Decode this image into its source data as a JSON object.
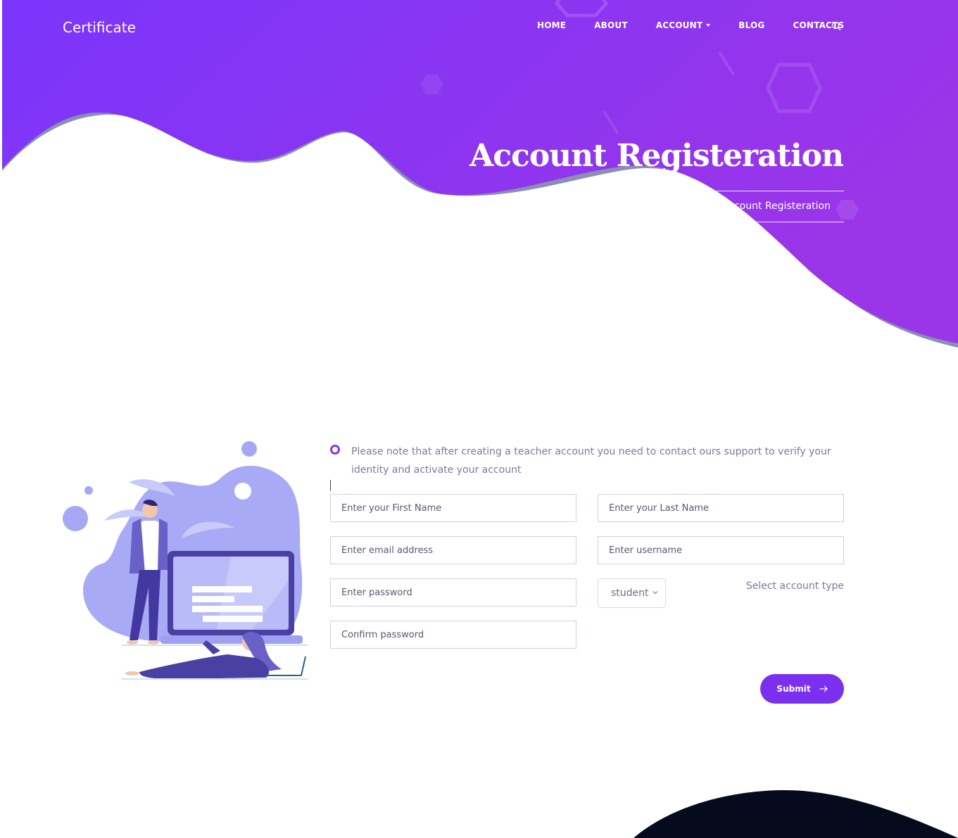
{
  "brand": {
    "name": "Certificate"
  },
  "nav": {
    "items": [
      "HOME",
      "ABOUT",
      "ACCOUNT",
      "BLOG",
      "CONTACTS"
    ],
    "search_icon": "search-icon"
  },
  "hero": {
    "title": "Account Registeration",
    "breadcrumb": "Account Registeration"
  },
  "form": {
    "note": "Please note that after creating a teacher account you need to contact ours support to verify your identity and activate your account",
    "first_name_placeholder": "Enter your First Name",
    "last_name_placeholder": "Enter your Last Name",
    "email_placeholder": "Enter email address",
    "username_placeholder": "Enter username",
    "password_placeholder": "Enter password",
    "confirm_placeholder": "Confirm password",
    "account_type_value": "student",
    "account_type_label": "Select account type",
    "submit_label": "Submit"
  },
  "colors": {
    "brand_purple": "#7b30f0",
    "hero_gradient_start": "#7b35fb",
    "hero_gradient_end": "#9b35e8",
    "wave_shadow": "#8a8fb3",
    "footer_dark": "#060a1d"
  }
}
